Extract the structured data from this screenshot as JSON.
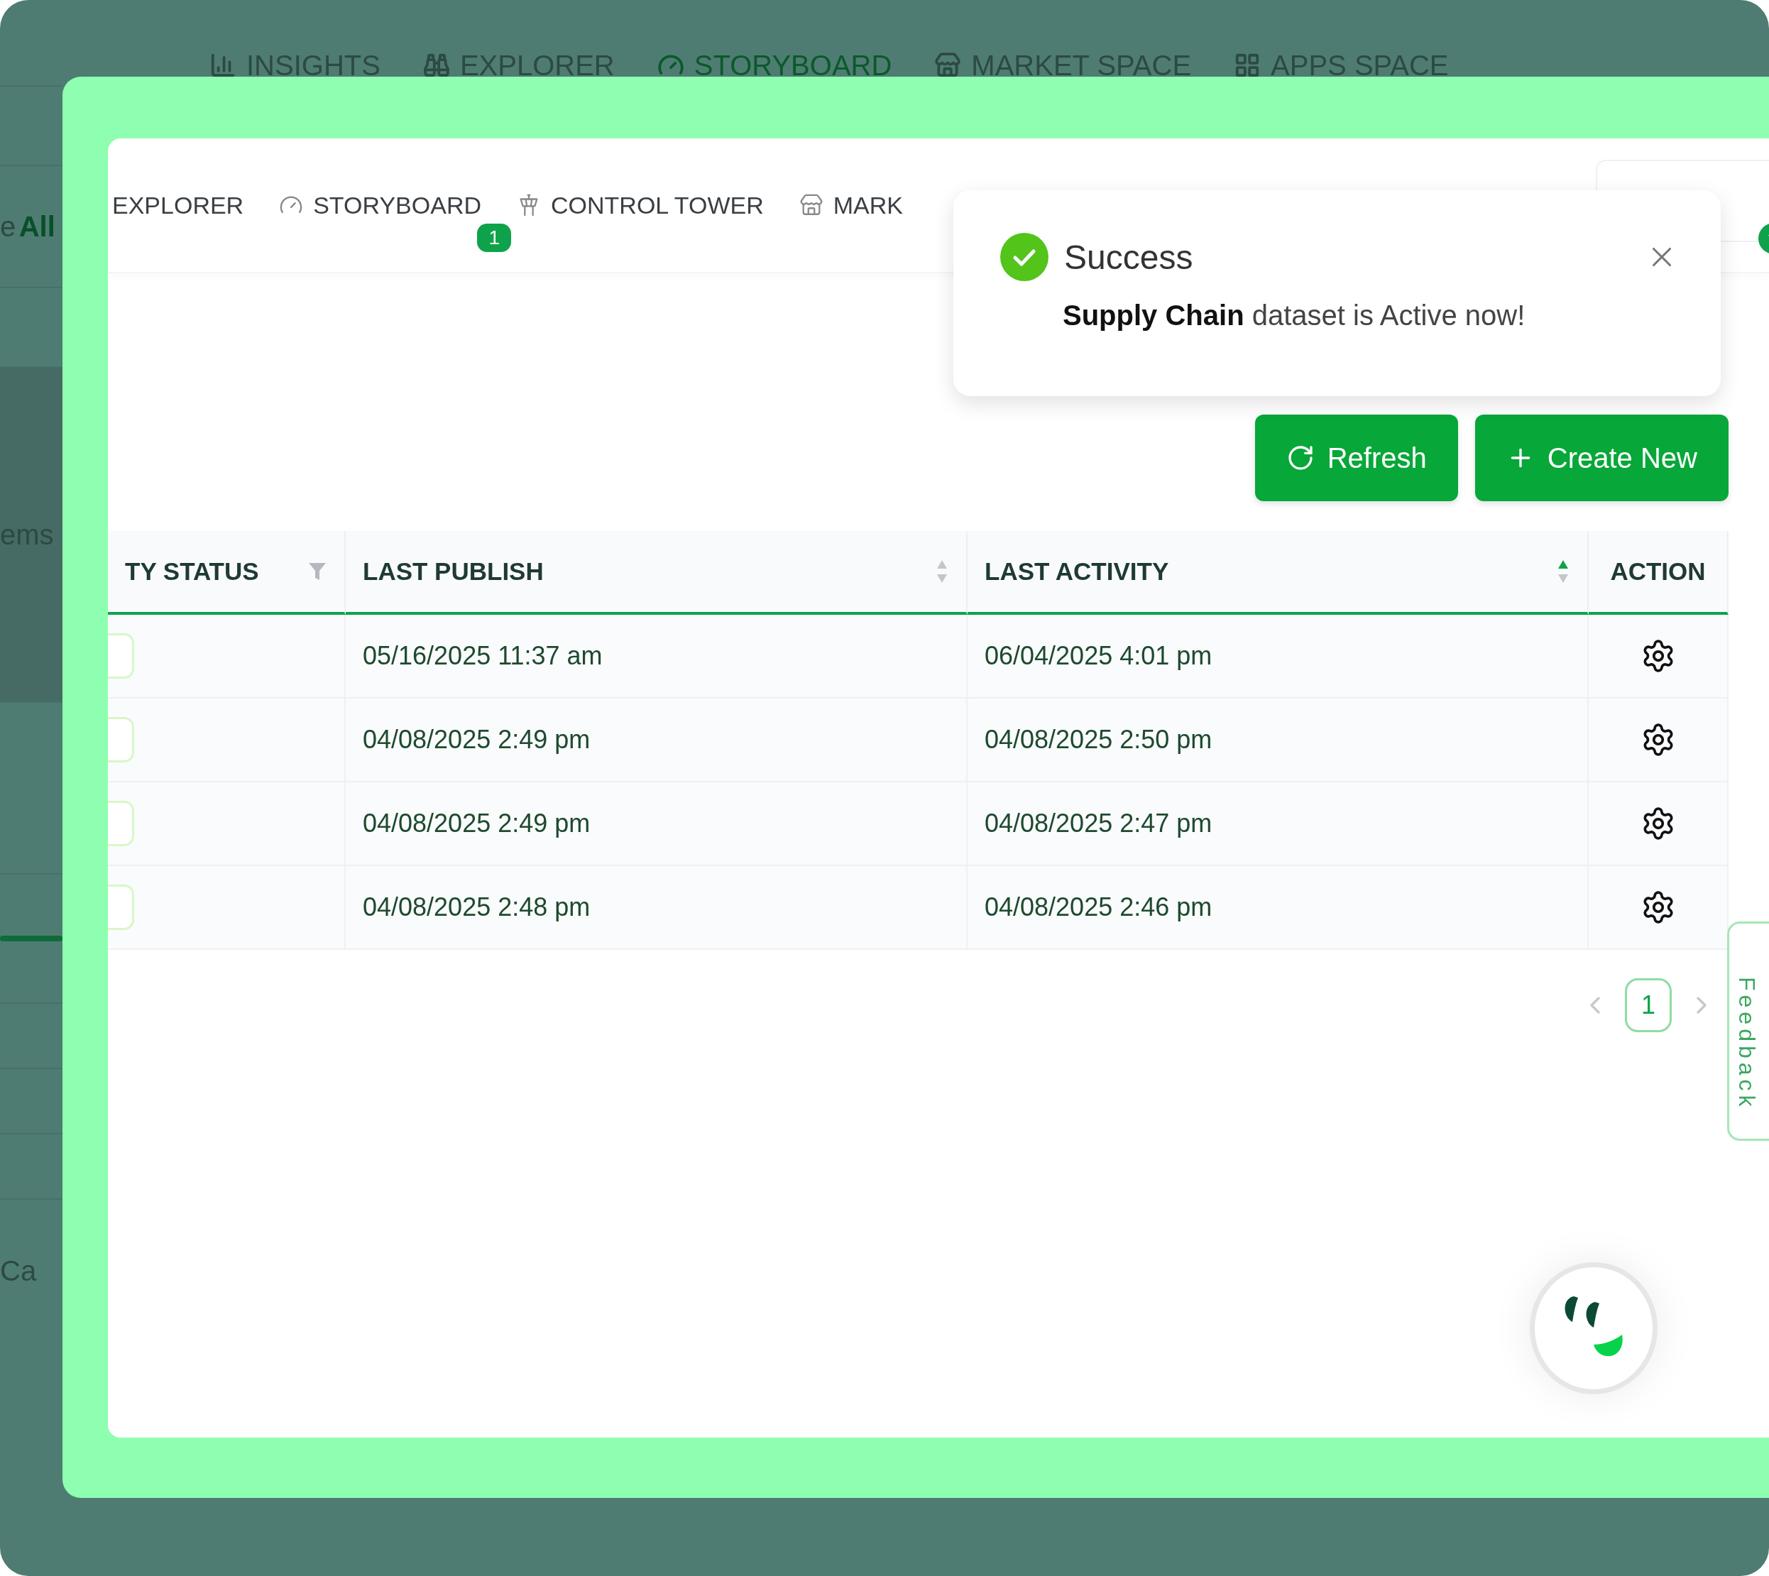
{
  "background_app": {
    "nav": [
      {
        "label": "INSIGHTS",
        "kind": "insights",
        "selected": false
      },
      {
        "label": "EXPLORER",
        "kind": "explorer",
        "selected": false
      },
      {
        "label": "STORYBOARD",
        "kind": "storyboard",
        "selected": true
      },
      {
        "label": "MARKET SPACE",
        "kind": "market",
        "selected": false
      },
      {
        "label": "APPS SPACE",
        "kind": "apps",
        "selected": false
      }
    ],
    "filter_label": "e",
    "filter_value": "All",
    "panel_text": "ems",
    "footer_text": "Ca"
  },
  "nav": [
    {
      "label": "EXPLORER",
      "kind": "explorer"
    },
    {
      "label": "STORYBOARD",
      "kind": "storyboard",
      "badge": "1"
    },
    {
      "label": "CONTROL TOWER",
      "kind": "tower"
    },
    {
      "label": "MARK",
      "kind": "market"
    }
  ],
  "toast": {
    "title": "Success",
    "message": "**Supply Chain** dataset is Active now!"
  },
  "buttons": [
    {
      "label": "Refresh",
      "kind": "refresh"
    },
    {
      "label": "Create New",
      "kind": "create"
    }
  ],
  "table": {
    "columns": [
      {
        "label": "TY STATUS",
        "kind": "filter"
      },
      {
        "label": "LAST PUBLISH",
        "kind": "sort",
        "sorted": false
      },
      {
        "label": "LAST ACTIVITY",
        "kind": "sort",
        "sorted": true
      },
      {
        "label": "ACTION",
        "kind": "plain"
      }
    ],
    "rows": [
      {
        "last_publish": "05/16/2025 11:37 am",
        "last_activity": "06/04/2025 4:01 pm"
      },
      {
        "last_publish": "04/08/2025 2:49 pm",
        "last_activity": "04/08/2025 2:50 pm"
      },
      {
        "last_publish": "04/08/2025 2:49 pm",
        "last_activity": "04/08/2025 2:47 pm"
      },
      {
        "last_publish": "04/08/2025 2:48 pm",
        "last_activity": "04/08/2025 2:46 pm"
      }
    ]
  },
  "pagination": {
    "pages": [
      {
        "label": "1",
        "selected": true
      }
    ]
  },
  "feedback": "Feedback"
}
